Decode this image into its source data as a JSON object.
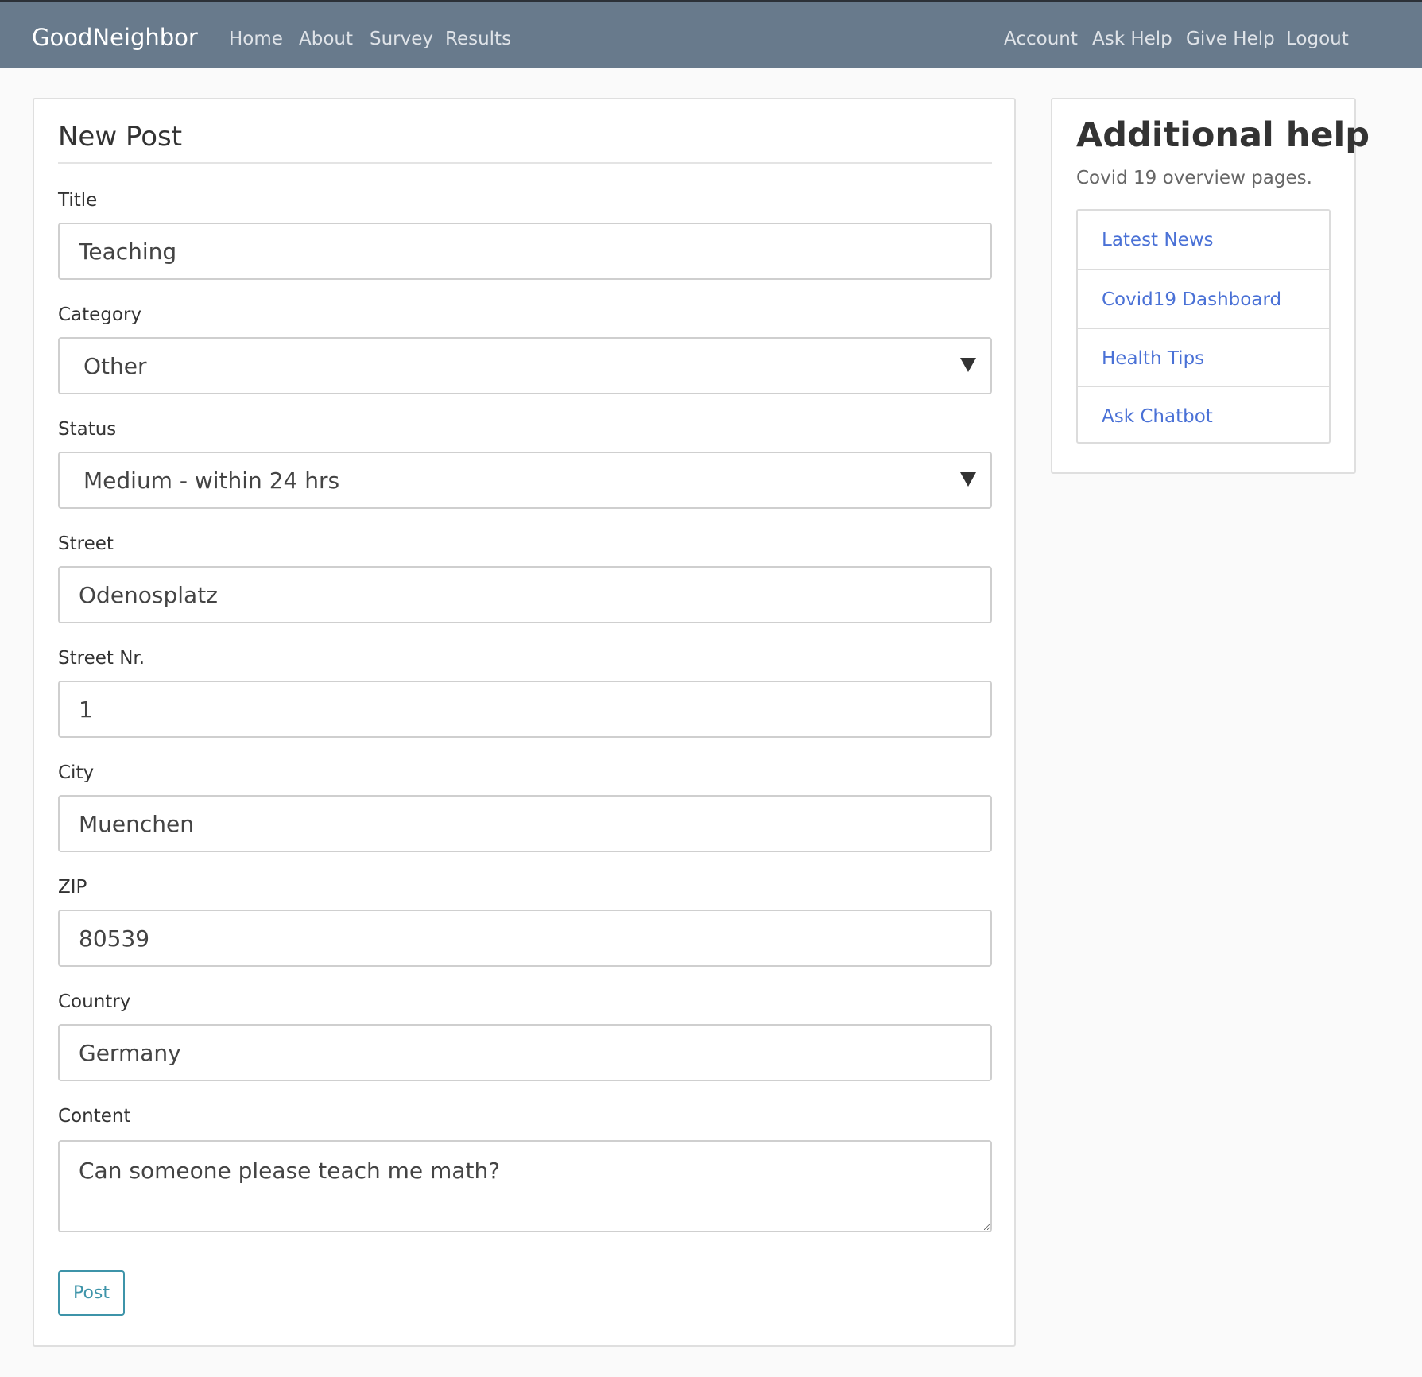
{
  "navbar": {
    "brand": "GoodNeighbor",
    "left_links": [
      "Home",
      "About",
      "Survey",
      "Results"
    ],
    "right_links": [
      "Account",
      "Ask Help",
      "Give Help",
      "Logout"
    ]
  },
  "form": {
    "legend": "New Post",
    "title_label": "Title",
    "title_value": "Teaching",
    "category_label": "Category",
    "category_value": "Other",
    "status_label": "Status",
    "status_value": "Medium - within 24 hrs",
    "street_label": "Street",
    "street_value": "Odenosplatz",
    "street_nr_label": "Street Nr.",
    "street_nr_value": "1",
    "city_label": "City",
    "city_value": "Muenchen",
    "zip_label": "ZIP",
    "zip_value": "80539",
    "country_label": "Country",
    "country_value": "Germany",
    "content_label": "Content",
    "content_value": "Can someone please teach me math?",
    "submit_label": "Post"
  },
  "sidebar": {
    "title": "Additional help",
    "subtitle": "Covid 19 overview pages.",
    "links": [
      "Latest News",
      "Covid19 Dashboard",
      "Health Tips",
      "Ask Chatbot"
    ]
  },
  "colors": {
    "navbar_bg": "#687a8c",
    "link": "#4a71d6",
    "button_accent": "#3e94a9"
  }
}
